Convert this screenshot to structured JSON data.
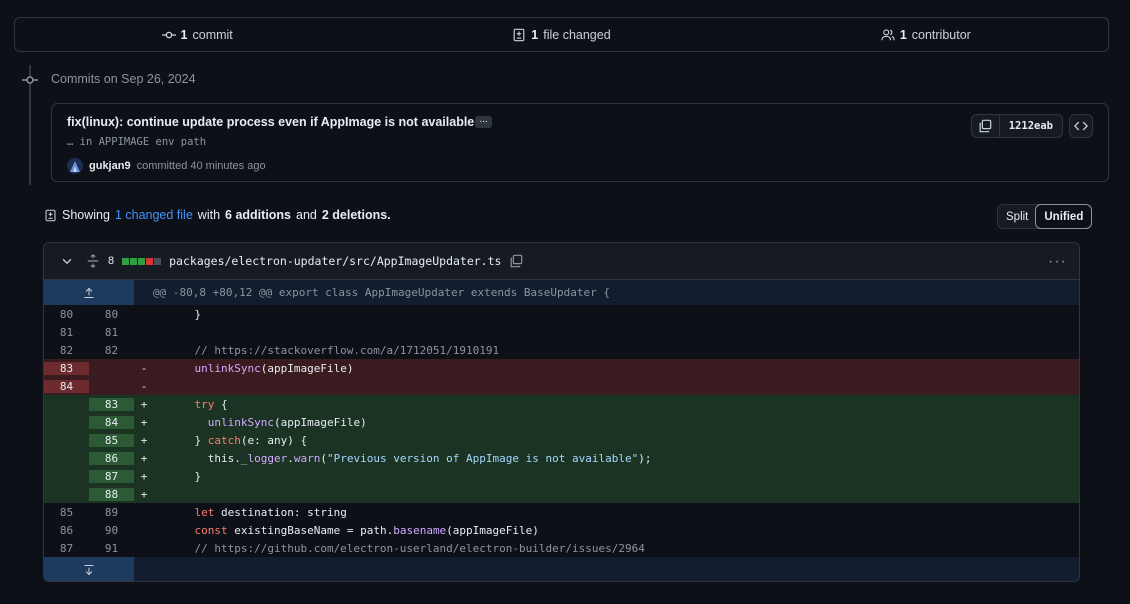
{
  "summary": {
    "commits_count": "1",
    "commits_label": "commit",
    "files_count": "1",
    "files_label": "file changed",
    "contributors_count": "1",
    "contributors_label": "contributor"
  },
  "timeline": {
    "date_label": "Commits on Sep 26, 2024"
  },
  "commit": {
    "title": "fix(linux): continue update process even if AppImage is not available...",
    "ellipsis": "...",
    "description": "… in APPIMAGE env path",
    "author": "gukjan9",
    "meta": "committed 40 minutes ago",
    "sha": "1212eab"
  },
  "showing": {
    "prefix": "Showing",
    "link": "1 changed file",
    "with": "with",
    "additions": "6 additions",
    "and": "and",
    "deletions": "2 deletions."
  },
  "view_toggle": {
    "split": "Split",
    "unified": "Unified",
    "selected": "Unified"
  },
  "diff": {
    "changes": "8",
    "path": "packages/electron-updater/src/AppImageUpdater.ts",
    "blocks": [
      "#2ea043",
      "#2ea043",
      "#2ea043",
      "#da3633",
      "#484f58"
    ],
    "hunk": "@@ -80,8 +80,12 @@ export class AppImageUpdater extends BaseUpdater {",
    "lines": [
      {
        "type": "ctx",
        "old": "80",
        "new": "80",
        "sign": "",
        "text": "    }"
      },
      {
        "type": "ctx",
        "old": "81",
        "new": "81",
        "sign": "",
        "text": ""
      },
      {
        "type": "ctx",
        "old": "82",
        "new": "82",
        "sign": "",
        "text": "    // https://stackoverflow.com/a/1712051/1910191"
      },
      {
        "type": "del",
        "old": "83",
        "new": "",
        "sign": "-",
        "text": "    unlinkSync(appImageFile)"
      },
      {
        "type": "del",
        "old": "84",
        "new": "",
        "sign": "-",
        "text": ""
      },
      {
        "type": "add",
        "old": "",
        "new": "83",
        "sign": "+",
        "text": "    try {"
      },
      {
        "type": "add",
        "old": "",
        "new": "84",
        "sign": "+",
        "text": "      unlinkSync(appImageFile)"
      },
      {
        "type": "add",
        "old": "",
        "new": "85",
        "sign": "+",
        "text": "    } catch(e: any) {"
      },
      {
        "type": "add",
        "old": "",
        "new": "86",
        "sign": "+",
        "text": "      this._logger.warn(\"Previous version of AppImage is not available\");"
      },
      {
        "type": "add",
        "old": "",
        "new": "87",
        "sign": "+",
        "text": "    }"
      },
      {
        "type": "add",
        "old": "",
        "new": "88",
        "sign": "+",
        "text": ""
      },
      {
        "type": "ctx",
        "old": "85",
        "new": "89",
        "sign": "",
        "text": "    let destination: string"
      },
      {
        "type": "ctx",
        "old": "86",
        "new": "90",
        "sign": "",
        "text": "    const existingBaseName = path.basename(appImageFile)"
      },
      {
        "type": "ctx",
        "old": "87",
        "new": "91",
        "sign": "",
        "text": "    // https://github.com/electron-userland/electron-builder/issues/2964"
      }
    ]
  }
}
